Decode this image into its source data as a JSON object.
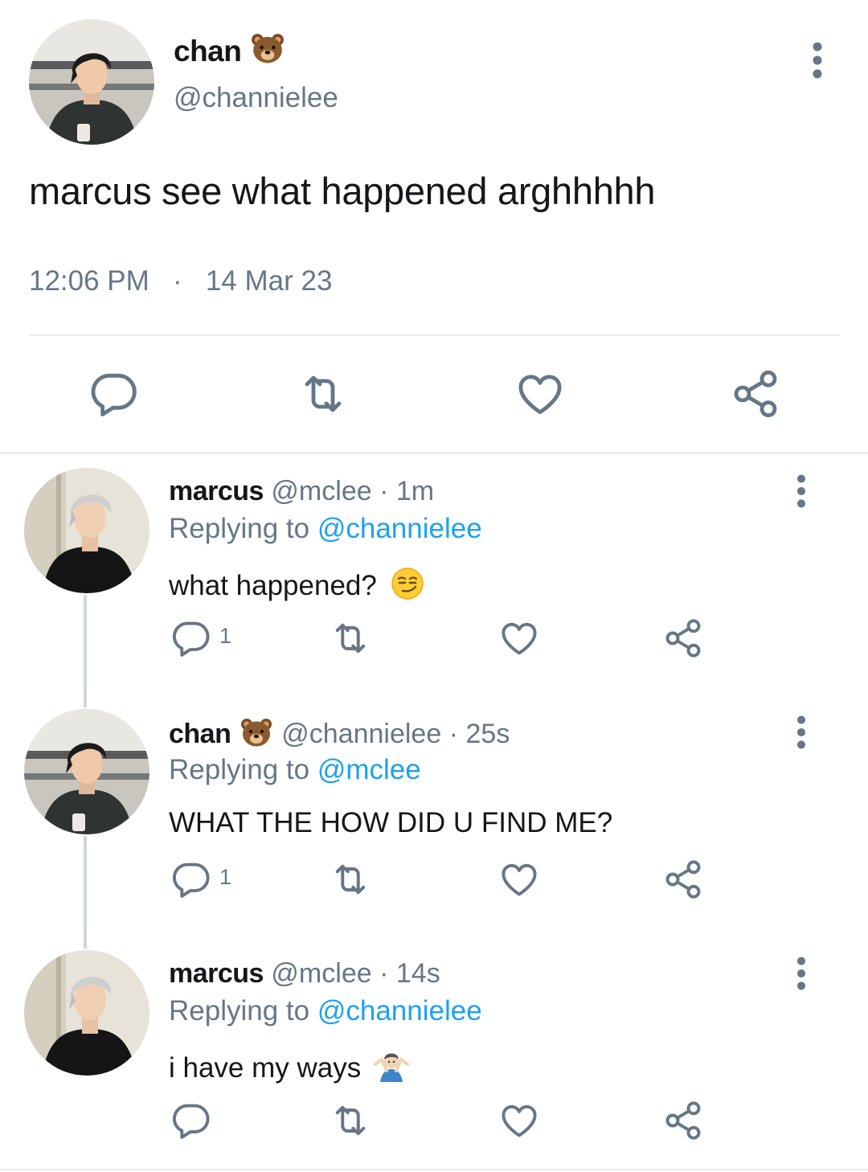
{
  "main_tweet": {
    "display_name": "chan",
    "name_emoji": "bear-face-emoji",
    "handle": "@channielee",
    "text": "marcus see what happened arghhhhh",
    "time": "12:06 PM",
    "separator": "·",
    "date": "14 Mar 23",
    "actions": [
      "reply-icon",
      "retweet-icon",
      "like-icon",
      "share-icon"
    ]
  },
  "replies": [
    {
      "name": "marcus",
      "handle": "@mclee",
      "dot": "·",
      "time": "1m",
      "replying_label": "Replying to",
      "replying_to": "@channielee",
      "text": "what happened?",
      "text_emoji": "smirking-face-emoji",
      "reply_count": "1"
    },
    {
      "name": "chan",
      "name_emoji": "bear-face-emoji",
      "handle": "@channielee",
      "dot": "·",
      "time": "25s",
      "replying_label": "Replying to",
      "replying_to": "@mclee",
      "text": "WHAT THE HOW DID U FIND ME?",
      "reply_count": "1"
    },
    {
      "name": "marcus",
      "handle": "@mclee",
      "dot": "·",
      "time": "14s",
      "replying_label": "Replying to",
      "replying_to": "@channielee",
      "text": "i have my ways",
      "text_emoji": "person-shrugging-emoji",
      "reply_count": ""
    }
  ],
  "colors": {
    "text": "#14171a",
    "secondary": "#657786",
    "link": "#1da1f2",
    "icon": "#657786",
    "divider": "#e6ecf0",
    "thread_line": "#ccd6dd"
  }
}
